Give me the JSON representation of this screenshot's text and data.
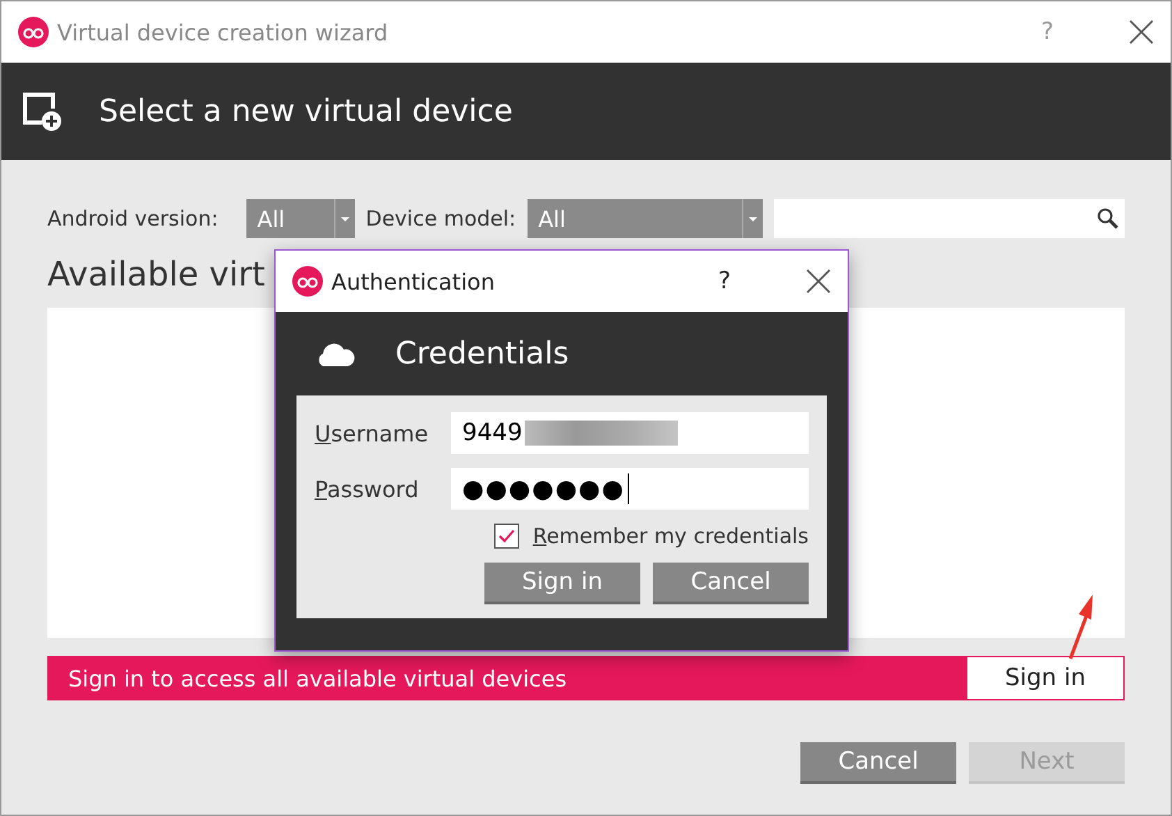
{
  "window": {
    "title": "Virtual device creation wizard",
    "help": "?",
    "header": "Select a new virtual device"
  },
  "filters": {
    "android_version_label": "Android version:",
    "android_version_value": "All",
    "device_model_label": "Device model:",
    "device_model_value": "All"
  },
  "section_title": "Available virt",
  "banner": {
    "text": "Sign in to access all available virtual devices",
    "button": "Sign in"
  },
  "buttons": [
    {
      "label": "Cancel",
      "disabled": false
    },
    {
      "label": "Next",
      "disabled": true
    }
  ],
  "dialog": {
    "title": "Authentication",
    "help": "?",
    "header": "Credentials",
    "fields": [
      {
        "label": "Username",
        "value": "9449",
        "kind": "text"
      },
      {
        "label": "Password",
        "value": "●●●●●●●",
        "kind": "password"
      }
    ],
    "remember": {
      "label": "Remember my credentials",
      "checked": true
    },
    "buttons": [
      {
        "label": "Sign in"
      },
      {
        "label": "Cancel"
      }
    ]
  }
}
